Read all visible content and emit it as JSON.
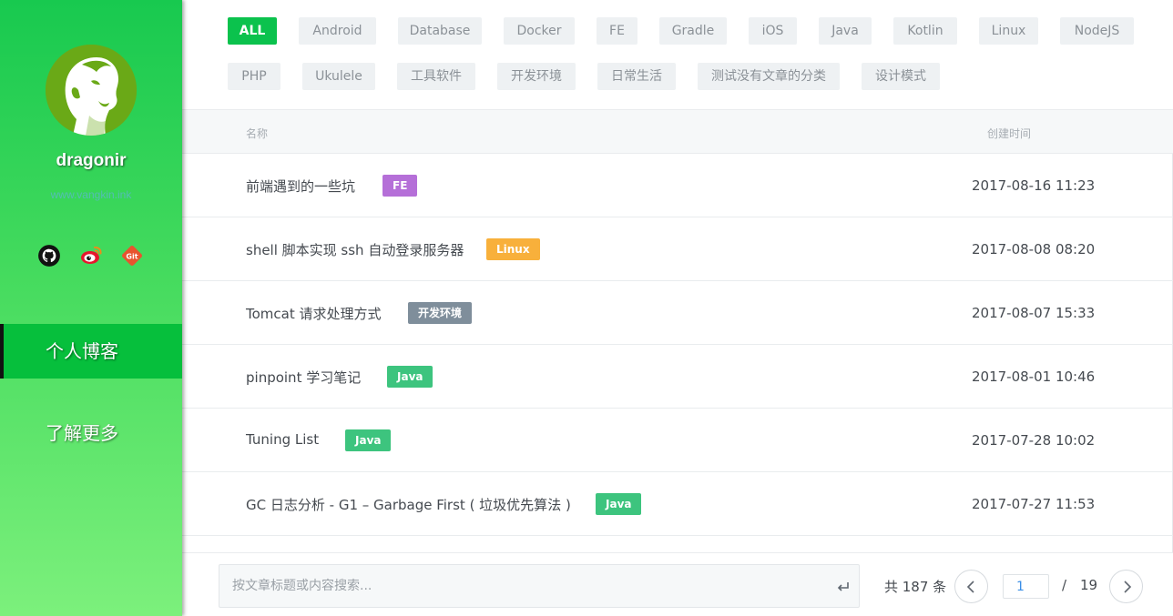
{
  "sidebar": {
    "username": "dragonir",
    "site_url": "www.vangkin.ink",
    "social": [
      {
        "icon": "github-icon"
      },
      {
        "icon": "weibo-icon"
      },
      {
        "icon": "git-icon"
      }
    ],
    "nav": [
      {
        "label": "个人博客",
        "active": true
      },
      {
        "label": "了解更多",
        "active": false
      }
    ]
  },
  "tags": [
    {
      "label": "ALL",
      "active": true
    },
    {
      "label": "Android"
    },
    {
      "label": "Database"
    },
    {
      "label": "Docker"
    },
    {
      "label": "FE"
    },
    {
      "label": "Gradle"
    },
    {
      "label": "iOS"
    },
    {
      "label": "Java"
    },
    {
      "label": "Kotlin"
    },
    {
      "label": "Linux"
    },
    {
      "label": "NodeJS"
    },
    {
      "label": "PHP"
    },
    {
      "label": "Ukulele"
    },
    {
      "label": "工具软件"
    },
    {
      "label": "开发环境"
    },
    {
      "label": "日常生活"
    },
    {
      "label": "测试没有文章的分类"
    },
    {
      "label": "设计模式"
    }
  ],
  "list": {
    "header_name": "名称",
    "header_date": "创建时间",
    "rows": [
      {
        "title": "前端遇到的一些坑",
        "tag": "FE",
        "tag_color": "#b56fd8",
        "date": "2017-08-16 11:23"
      },
      {
        "title": "shell 脚本实现 ssh 自动登录服务器",
        "tag": "Linux",
        "tag_color": "#f8b03b",
        "date": "2017-08-08 08:20"
      },
      {
        "title": "Tomcat 请求处理方式",
        "tag": "开发环境",
        "tag_color": "#7f8e9b",
        "date": "2017-08-07 15:33"
      },
      {
        "title": "pinpoint 学习笔记",
        "tag": "Java",
        "tag_color": "#3dc47e",
        "date": "2017-08-01 10:46"
      },
      {
        "title": "Tuning List",
        "tag": "Java",
        "tag_color": "#3dc47e",
        "date": "2017-07-28 10:02"
      },
      {
        "title": "GC 日志分析 - G1 – Garbage First ( 垃圾优先算法 )",
        "tag": "Java",
        "tag_color": "#3dc47e",
        "date": "2017-07-27 11:53"
      }
    ]
  },
  "footer": {
    "search_placeholder": "按文章标题或内容搜索...",
    "total_label": "共 187 条",
    "current_page": "1",
    "page_sep": "/",
    "total_pages": "19"
  }
}
